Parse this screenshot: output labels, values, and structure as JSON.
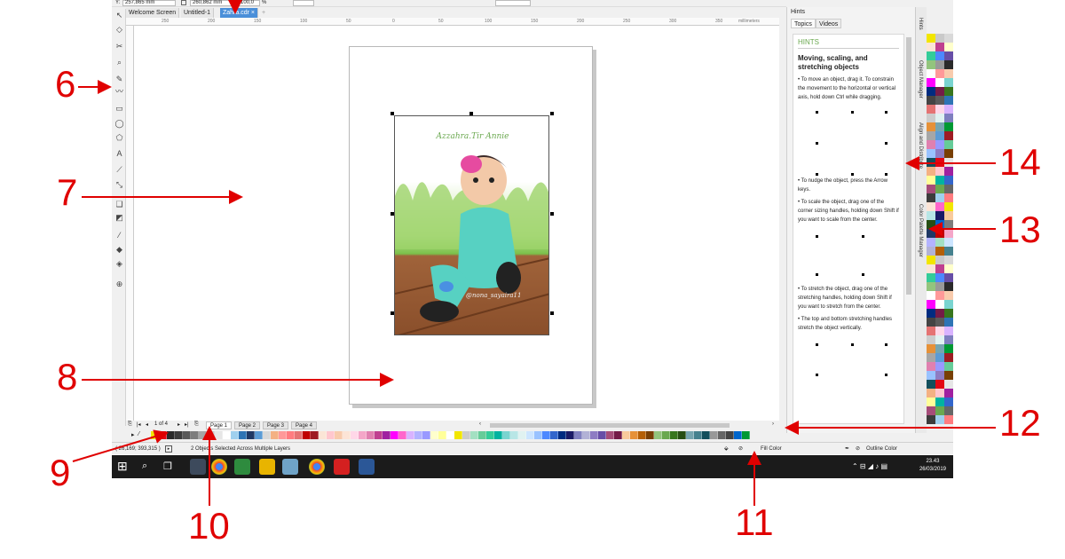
{
  "property_bar": {
    "y_field": "257,865 mm",
    "height_field": "260,862 mm",
    "scale_field": "100,0",
    "percent": "%"
  },
  "doc_tabs": [
    "Welcome Screen",
    "Untitled-1",
    "Zahra.cdr"
  ],
  "ruler_unit": "millimeters",
  "ruler_ticks": [
    "250",
    "200",
    "150",
    "100",
    "50",
    "0",
    "50",
    "100",
    "150",
    "200",
    "250",
    "300",
    "350"
  ],
  "page_nav": {
    "counter": "1 of 4",
    "pages": [
      "Page 1",
      "Page 2",
      "Page 3",
      "Page 4"
    ]
  },
  "status": {
    "coords": "( 26,169; 393,315 )",
    "message": "2 Objects Selected Across Multiple Layers",
    "fill": "Fill Color",
    "outline": "Outline Color"
  },
  "art": {
    "title": "Azzahra.Tir Annie",
    "credit": "@nona_sayaira11"
  },
  "hints": {
    "panel_title": "Hints",
    "tabs": [
      "Topics",
      "Videos"
    ],
    "heading": "HINTS",
    "subtitle": "Moving, scaling, and stretching objects",
    "p1": "• To move an object, drag it. To constrain the movement to the horizontal or vertical axis, hold down Ctrl while dragging.",
    "p2": "• To nudge the object, press the Arrow keys.",
    "p3": "• To scale the object, drag one of the corner sizing handles, holding down Shift if you want to scale from the center.",
    "p4": "• To stretch the object, drag one of the stretching handles, holding down Shift if you want to stretch from the center.",
    "p5": "• The top and bottom stretching handles stretch the object vertically."
  },
  "dock_tabs": [
    "Hints",
    "Object Manager",
    "Align and Distribute",
    "Color Palette Manager"
  ],
  "taskbar": {
    "time": "23.43",
    "date": "26/03/2019"
  },
  "callouts": [
    "6",
    "7",
    "8",
    "9",
    "10",
    "11",
    "12",
    "13",
    "14"
  ],
  "palette_colors": [
    "#f2e600",
    "#e30613",
    "#2a2a2a",
    "#3c3c3c",
    "#5a5a5a",
    "#7d7d7d",
    "#a6a6a6",
    "#c9c9c9",
    "#e6e6e6",
    "#ffffff",
    "#9fd0ee",
    "#2e74b5",
    "#1f3864",
    "#5b9bd5",
    "#d9d9d9",
    "#f4b183",
    "#ff9999",
    "#ff7c80",
    "#e57373",
    "#c00000",
    "#9e1c23",
    "#fbe5d6",
    "#ffc7ce",
    "#f8cbad",
    "#fce4d6",
    "#ffd7e8",
    "#f4a6c8",
    "#e080b0",
    "#c04090",
    "#a020a0",
    "#ff00ff",
    "#ff66cc",
    "#d9b3ff",
    "#b3b3ff",
    "#9999ff",
    "#ffffcc",
    "#ffff99",
    "#ffffff",
    "#f2e600",
    "#cccccc",
    "#a3e0c2",
    "#66cc99",
    "#33cc99",
    "#00b3a0",
    "#79d4d0",
    "#b8e6e6",
    "#e0f2f1",
    "#cce5ff",
    "#99c2ff",
    "#4d88ff",
    "#3366cc",
    "#002b80",
    "#1a1a66",
    "#7f7fbf",
    "#b2b2d6",
    "#8e7cc3",
    "#674ea7",
    "#a64d79",
    "#741b47",
    "#f9cb9c",
    "#e69138",
    "#b45f06",
    "#783f04",
    "#93c47d",
    "#6aa84f",
    "#38761d",
    "#274e13",
    "#76a5af",
    "#45818e",
    "#134f5c",
    "#999999",
    "#666666",
    "#444444",
    "#0066cc",
    "#009933"
  ]
}
